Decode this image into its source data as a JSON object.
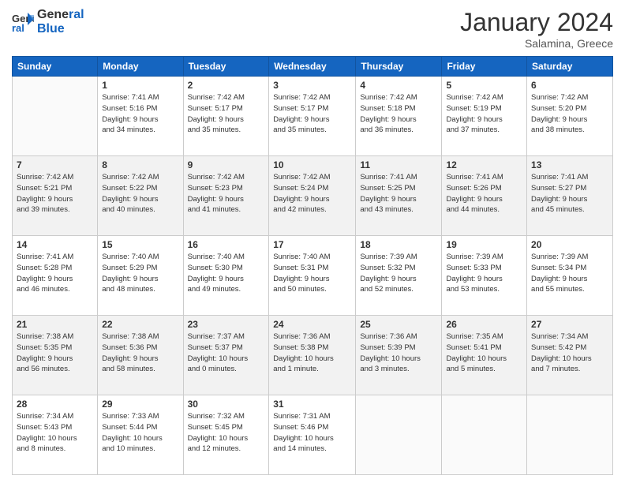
{
  "header": {
    "logo_line1": "General",
    "logo_line2": "Blue",
    "month_title": "January 2024",
    "location": "Salamina, Greece"
  },
  "weekdays": [
    "Sunday",
    "Monday",
    "Tuesday",
    "Wednesday",
    "Thursday",
    "Friday",
    "Saturday"
  ],
  "weeks": [
    [
      {
        "day": "",
        "info": ""
      },
      {
        "day": "1",
        "info": "Sunrise: 7:41 AM\nSunset: 5:16 PM\nDaylight: 9 hours\nand 34 minutes."
      },
      {
        "day": "2",
        "info": "Sunrise: 7:42 AM\nSunset: 5:17 PM\nDaylight: 9 hours\nand 35 minutes."
      },
      {
        "day": "3",
        "info": "Sunrise: 7:42 AM\nSunset: 5:17 PM\nDaylight: 9 hours\nand 35 minutes."
      },
      {
        "day": "4",
        "info": "Sunrise: 7:42 AM\nSunset: 5:18 PM\nDaylight: 9 hours\nand 36 minutes."
      },
      {
        "day": "5",
        "info": "Sunrise: 7:42 AM\nSunset: 5:19 PM\nDaylight: 9 hours\nand 37 minutes."
      },
      {
        "day": "6",
        "info": "Sunrise: 7:42 AM\nSunset: 5:20 PM\nDaylight: 9 hours\nand 38 minutes."
      }
    ],
    [
      {
        "day": "7",
        "info": "Sunrise: 7:42 AM\nSunset: 5:21 PM\nDaylight: 9 hours\nand 39 minutes."
      },
      {
        "day": "8",
        "info": "Sunrise: 7:42 AM\nSunset: 5:22 PM\nDaylight: 9 hours\nand 40 minutes."
      },
      {
        "day": "9",
        "info": "Sunrise: 7:42 AM\nSunset: 5:23 PM\nDaylight: 9 hours\nand 41 minutes."
      },
      {
        "day": "10",
        "info": "Sunrise: 7:42 AM\nSunset: 5:24 PM\nDaylight: 9 hours\nand 42 minutes."
      },
      {
        "day": "11",
        "info": "Sunrise: 7:41 AM\nSunset: 5:25 PM\nDaylight: 9 hours\nand 43 minutes."
      },
      {
        "day": "12",
        "info": "Sunrise: 7:41 AM\nSunset: 5:26 PM\nDaylight: 9 hours\nand 44 minutes."
      },
      {
        "day": "13",
        "info": "Sunrise: 7:41 AM\nSunset: 5:27 PM\nDaylight: 9 hours\nand 45 minutes."
      }
    ],
    [
      {
        "day": "14",
        "info": "Sunrise: 7:41 AM\nSunset: 5:28 PM\nDaylight: 9 hours\nand 46 minutes."
      },
      {
        "day": "15",
        "info": "Sunrise: 7:40 AM\nSunset: 5:29 PM\nDaylight: 9 hours\nand 48 minutes."
      },
      {
        "day": "16",
        "info": "Sunrise: 7:40 AM\nSunset: 5:30 PM\nDaylight: 9 hours\nand 49 minutes."
      },
      {
        "day": "17",
        "info": "Sunrise: 7:40 AM\nSunset: 5:31 PM\nDaylight: 9 hours\nand 50 minutes."
      },
      {
        "day": "18",
        "info": "Sunrise: 7:39 AM\nSunset: 5:32 PM\nDaylight: 9 hours\nand 52 minutes."
      },
      {
        "day": "19",
        "info": "Sunrise: 7:39 AM\nSunset: 5:33 PM\nDaylight: 9 hours\nand 53 minutes."
      },
      {
        "day": "20",
        "info": "Sunrise: 7:39 AM\nSunset: 5:34 PM\nDaylight: 9 hours\nand 55 minutes."
      }
    ],
    [
      {
        "day": "21",
        "info": "Sunrise: 7:38 AM\nSunset: 5:35 PM\nDaylight: 9 hours\nand 56 minutes."
      },
      {
        "day": "22",
        "info": "Sunrise: 7:38 AM\nSunset: 5:36 PM\nDaylight: 9 hours\nand 58 minutes."
      },
      {
        "day": "23",
        "info": "Sunrise: 7:37 AM\nSunset: 5:37 PM\nDaylight: 10 hours\nand 0 minutes."
      },
      {
        "day": "24",
        "info": "Sunrise: 7:36 AM\nSunset: 5:38 PM\nDaylight: 10 hours\nand 1 minute."
      },
      {
        "day": "25",
        "info": "Sunrise: 7:36 AM\nSunset: 5:39 PM\nDaylight: 10 hours\nand 3 minutes."
      },
      {
        "day": "26",
        "info": "Sunrise: 7:35 AM\nSunset: 5:41 PM\nDaylight: 10 hours\nand 5 minutes."
      },
      {
        "day": "27",
        "info": "Sunrise: 7:34 AM\nSunset: 5:42 PM\nDaylight: 10 hours\nand 7 minutes."
      }
    ],
    [
      {
        "day": "28",
        "info": "Sunrise: 7:34 AM\nSunset: 5:43 PM\nDaylight: 10 hours\nand 8 minutes."
      },
      {
        "day": "29",
        "info": "Sunrise: 7:33 AM\nSunset: 5:44 PM\nDaylight: 10 hours\nand 10 minutes."
      },
      {
        "day": "30",
        "info": "Sunrise: 7:32 AM\nSunset: 5:45 PM\nDaylight: 10 hours\nand 12 minutes."
      },
      {
        "day": "31",
        "info": "Sunrise: 7:31 AM\nSunset: 5:46 PM\nDaylight: 10 hours\nand 14 minutes."
      },
      {
        "day": "",
        "info": ""
      },
      {
        "day": "",
        "info": ""
      },
      {
        "day": "",
        "info": ""
      }
    ]
  ]
}
